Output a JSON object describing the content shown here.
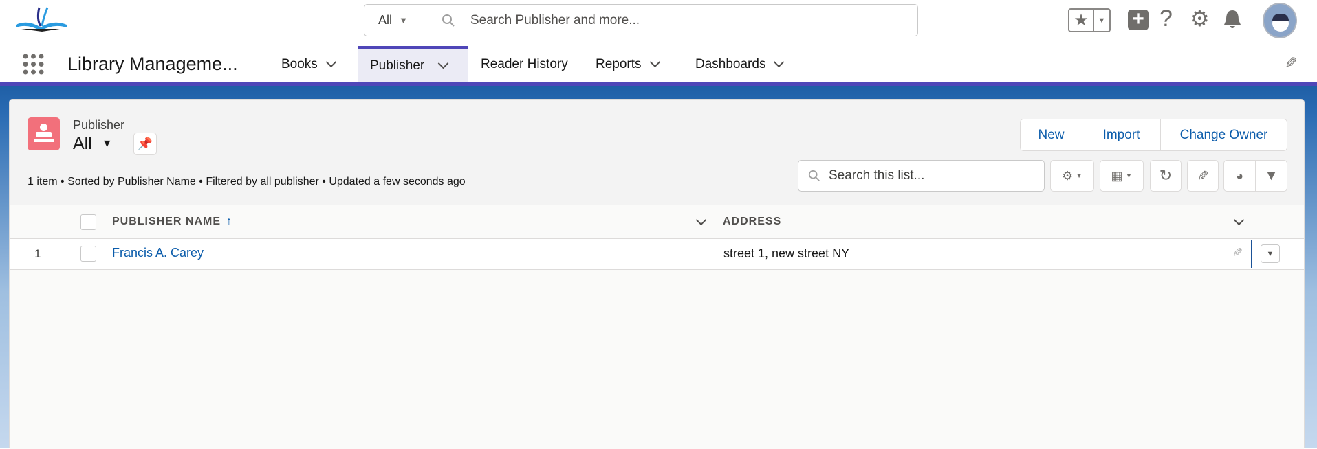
{
  "header": {
    "search_scope": "All",
    "search_placeholder": "Search Publisher and more...",
    "icons": [
      "logo-book-icon",
      "favorites-star-icon",
      "chevron-down-icon",
      "add-icon",
      "help-icon",
      "setup-gear-icon",
      "notification-bell-icon",
      "avatar"
    ]
  },
  "nav": {
    "app_name": "Library Manageme...",
    "tabs": [
      {
        "label": "Books",
        "has_menu": true
      },
      {
        "label": "Publisher",
        "has_menu": true,
        "active": true
      },
      {
        "label": "Reader History",
        "has_menu": false
      },
      {
        "label": "Reports",
        "has_menu": true
      },
      {
        "label": "Dashboards",
        "has_menu": true
      }
    ]
  },
  "list": {
    "object_label": "Publisher",
    "view_name": "All",
    "info": "1 item • Sorted by Publisher Name • Filtered by all publisher • Updated a few seconds ago",
    "actions": {
      "new": "New",
      "import": "Import",
      "change_owner": "Change Owner"
    },
    "search_placeholder": "Search this list...",
    "columns": [
      "PUBLISHER NAME",
      "ADDRESS"
    ],
    "sort_indicator": "↑",
    "rows": [
      {
        "num": "1",
        "name": "Francis A. Carey",
        "address": "street 1, new street NY"
      }
    ]
  },
  "colors": {
    "accent": "#4f46b8",
    "link": "#0b5cab",
    "object_icon": "#f2707b",
    "banner": "#1f5fa6"
  }
}
